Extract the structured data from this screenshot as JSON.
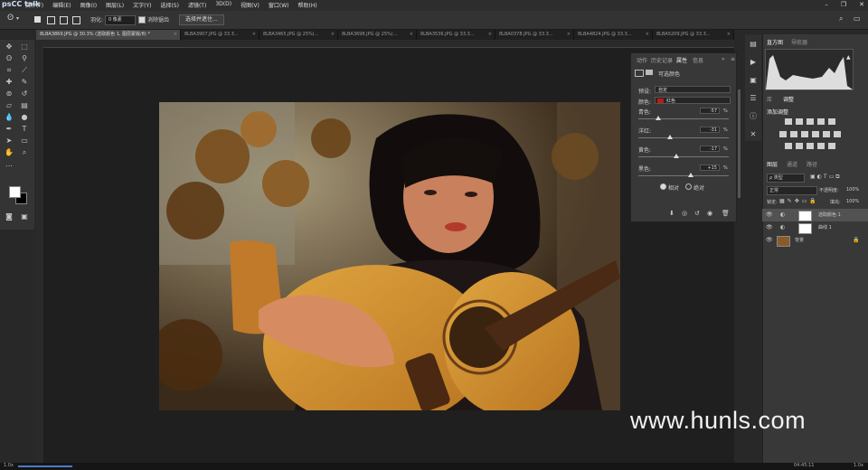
{
  "menubar": {
    "logo": "psCC talk",
    "items": [
      "文件(F)",
      "编辑(E)",
      "图像(I)",
      "图层(L)",
      "文字(Y)",
      "选择(S)",
      "滤镜(T)",
      "3D(D)",
      "视图(V)",
      "窗口(W)",
      "帮助(H)"
    ]
  },
  "options": {
    "feather_label": "羽化:",
    "feather_value": "0 像素",
    "antialias_label": "消除锯齿",
    "select_mask_label": "选择并遮住..."
  },
  "tabs": [
    {
      "label": "8LBA3869.JPG @ 30.3% (选取颜色 1, 图层蒙版/8) *",
      "active": true
    },
    {
      "label": "8LBA3907.JPG @ 33.3...",
      "active": false
    },
    {
      "label": "8LBA3465.JPG @ 25%(...",
      "active": false
    },
    {
      "label": "8LBA3698.JPG @ 25%(...",
      "active": false
    },
    {
      "label": "8LBA3536.JPG @ 33.3...",
      "active": false
    },
    {
      "label": "8LBA0378.JPG @ 33.3...",
      "active": false
    },
    {
      "label": "8LBA4824.JPG @ 33.3...",
      "active": false
    },
    {
      "label": "8LBA5209.JPG @ 33.3...",
      "active": false
    }
  ],
  "properties": {
    "tabs": [
      "动作",
      "历史记录",
      "属性",
      "信息"
    ],
    "active_tab": "属性",
    "header": "可选颜色",
    "preset_label": "预设:",
    "preset_value": "自定",
    "colors_label": "颜色:",
    "colors_value": "红色",
    "colors_swatch": "#c01818",
    "sliders": [
      {
        "label": "青色:",
        "value": "-57",
        "pct": "%",
        "level": 0.215
      },
      {
        "label": "洋红:",
        "value": "-31",
        "pct": "%",
        "level": 0.345
      },
      {
        "label": "黄色:",
        "value": "-17",
        "pct": "%",
        "level": 0.415
      },
      {
        "label": "黑色:",
        "value": "+15",
        "pct": "%",
        "level": 0.575
      }
    ],
    "method_relative": "相对",
    "method_absolute": "绝对"
  },
  "right_panels": {
    "histogram_tab": "直方图",
    "navigator_tab": "导航器",
    "library_tab": "库",
    "adjust_tab": "调整",
    "add_adjustment": "添加调整",
    "layers_tab": "图层",
    "channels_tab": "通道",
    "paths_tab": "路径",
    "kind_label": "ρ 类型",
    "blend_mode": "正常",
    "opacity_label": "不透明度:",
    "opacity_value": "100%",
    "lock_label": "锁定:",
    "fill_label": "填充:",
    "fill_value": "100%"
  },
  "layers": [
    {
      "name": "选取颜色 1",
      "selected": true
    },
    {
      "name": "曲线 1",
      "selected": false
    },
    {
      "name": "背景",
      "selected": false
    }
  ],
  "statusbar": {
    "left": "1.0x",
    "right": "1.0x",
    "time": "04:45:11"
  },
  "watermark": "www.hunls.com"
}
